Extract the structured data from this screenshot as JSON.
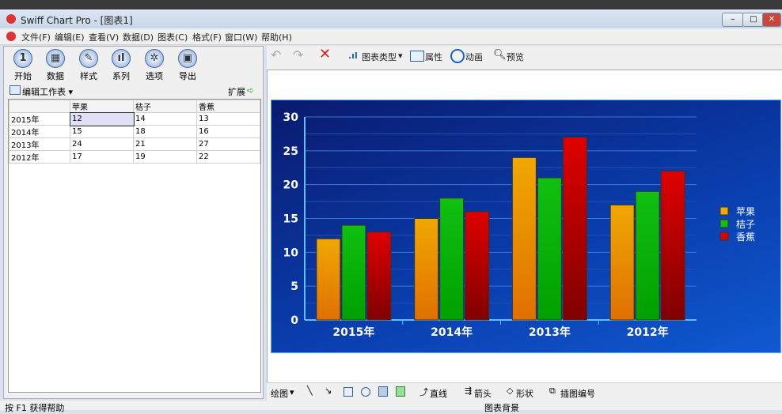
{
  "window": {
    "title": "Swiff Chart Pro - [图表1]"
  },
  "menu": [
    "文件(F)",
    "编辑(E)",
    "查看(V)",
    "数据(D)",
    "图表(C)",
    "格式(F)",
    "窗口(W)",
    "帮助(H)"
  ],
  "ribbon": [
    {
      "label": "开始",
      "icon": "1"
    },
    {
      "label": "数据",
      "icon": "▦"
    },
    {
      "label": "样式",
      "icon": "✎"
    },
    {
      "label": "系列",
      "icon": "ıl"
    },
    {
      "label": "选项",
      "icon": "✲"
    },
    {
      "label": "导出",
      "icon": "▣"
    }
  ],
  "sheet": {
    "edit_label": "编辑工作表 ▾",
    "expand_label": "扩展",
    "headers": [
      "",
      "苹果",
      "桔子",
      "香蕉"
    ],
    "rows": [
      [
        "2015年",
        "12",
        "14",
        "13"
      ],
      [
        "2014年",
        "15",
        "18",
        "16"
      ],
      [
        "2013年",
        "24",
        "21",
        "27"
      ],
      [
        "2012年",
        "17",
        "19",
        "22"
      ]
    ]
  },
  "toolbar": {
    "chart_type": "图表类型",
    "properties": "属性",
    "animation": "动画",
    "preview": "预览"
  },
  "drawbar": {
    "draw": "绘图",
    "line": "直线",
    "arrow": "箭头",
    "shape": "形状",
    "callout": "插图编号"
  },
  "status": {
    "help": "按 F1 获得帮助",
    "selection": "图表背景"
  },
  "chart_data": {
    "type": "bar",
    "categories": [
      "2015年",
      "2014年",
      "2013年",
      "2012年"
    ],
    "series": [
      {
        "name": "苹果",
        "values": [
          12,
          15,
          24,
          17
        ],
        "color": "#f0a800"
      },
      {
        "name": "桔子",
        "values": [
          14,
          18,
          21,
          19
        ],
        "color": "#10c010"
      },
      {
        "name": "香蕉",
        "values": [
          13,
          16,
          27,
          22
        ],
        "color": "#e00000"
      }
    ],
    "ylim": [
      0,
      30
    ],
    "yticks": [
      0,
      5,
      10,
      15,
      20,
      25,
      30
    ],
    "legend": "right"
  }
}
